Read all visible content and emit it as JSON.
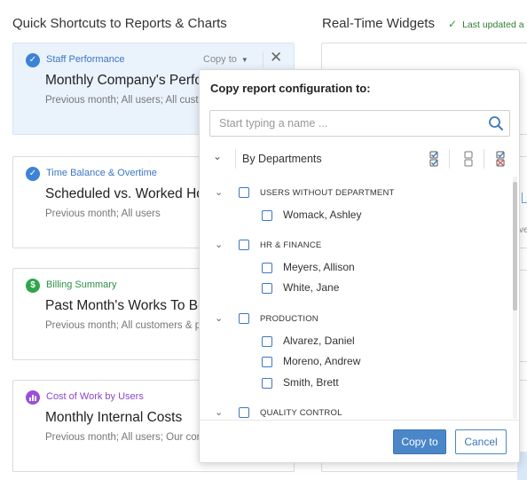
{
  "left_section": {
    "title": "Quick Shortcuts to Reports & Charts"
  },
  "right_section": {
    "title": "Real-Time Widgets",
    "updated_text": "Last updated a f",
    "peek_text": "ve"
  },
  "cards": [
    {
      "kind": "Staff Performance",
      "name": "Monthly Company's Perfo",
      "desc": "Previous month; All users; All custon",
      "badge_color": "#3d82d6",
      "kind_color": "#3a76c2",
      "icon": "check-badge-icon",
      "badge_glyph": "✓",
      "copy_label": "Copy to"
    },
    {
      "kind": "Time Balance & Overtime",
      "name": "Scheduled vs. Worked Ho",
      "desc": "Previous month; All users",
      "badge_color": "#3d82d6",
      "kind_color": "#3a76c2",
      "icon": "check-badge-icon",
      "badge_glyph": "✓"
    },
    {
      "kind": "Billing Summary",
      "name": "Past Month's Works To Be",
      "desc": "Previous month; All customers & pro",
      "badge_color": "#31a54c",
      "kind_color": "#2f8f45",
      "icon": "dollar-badge-icon",
      "badge_glyph": "$"
    },
    {
      "kind": "Cost of Work by Users",
      "name": "Monthly Internal Costs",
      "desc": "Previous month; All users; Our comp",
      "badge_color": "#9a4fd9",
      "kind_color": "#8c46cc",
      "icon": "chart-badge-icon",
      "badge_glyph": "▮"
    }
  ],
  "popup": {
    "title": "Copy report configuration to:",
    "search_placeholder": "Start typing a name ...",
    "group_by": "By Departments",
    "groups": [
      {
        "label": "USERS WITHOUT DEPARTMENT",
        "users": [
          "Womack, Ashley"
        ]
      },
      {
        "label": "HR & FINANCE",
        "users": [
          "Meyers, Allison",
          "White, Jane"
        ]
      },
      {
        "label": "PRODUCTION",
        "users": [
          "Alvarez, Daniel",
          "Moreno, Andrew",
          "Smith, Brett"
        ]
      },
      {
        "label": "QUALITY CONTROL",
        "users": []
      }
    ],
    "copy_button": "Copy to",
    "cancel_button": "Cancel"
  },
  "colors": {
    "accent": "#4a86c8",
    "checkbox": "#3f76c1",
    "success": "#2e9b3e"
  }
}
